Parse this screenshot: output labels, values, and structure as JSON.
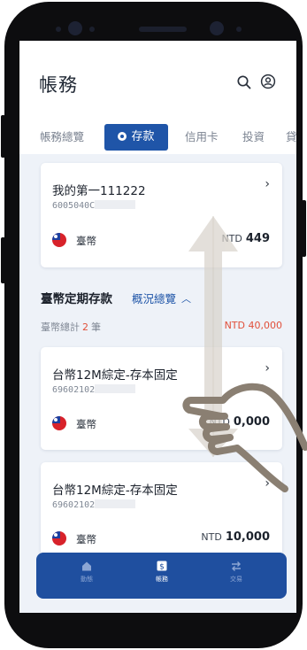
{
  "header": {
    "title": "帳務",
    "icons": [
      "search-icon",
      "profile-icon"
    ]
  },
  "tabs": [
    {
      "label": "帳務總覽"
    },
    {
      "label": "存款",
      "active": true
    },
    {
      "label": "信用卡"
    },
    {
      "label": "投資"
    },
    {
      "label": "貸"
    }
  ],
  "accounts": [
    {
      "name": "我的第一111222",
      "number": "6005040C",
      "currency": "臺幣",
      "ccy": "NTD",
      "balance": "449"
    }
  ],
  "fixed_deposit": {
    "section_title": "臺幣定期存款",
    "overview_link": "概況總覽",
    "total_label": "臺幣總計",
    "total_count": "2",
    "total_unit": "筆",
    "total_ccy": "NTD",
    "total_amount": "40,000",
    "items": [
      {
        "name": "台幣12M綜定-存本固定",
        "number": "69602102",
        "currency": "臺幣",
        "ccy": "NTD",
        "balance": "0,000"
      },
      {
        "name": "台幣12M綜定-存本固定",
        "number": "69602102",
        "currency": "臺幣",
        "ccy": "NTD",
        "balance": "10,000"
      }
    ]
  },
  "bottom_nav": [
    {
      "label": "動態",
      "icon": "home-icon"
    },
    {
      "label": "帳務",
      "icon": "dollar-icon",
      "active": true
    },
    {
      "label": "交易",
      "icon": "transfer-icon"
    }
  ],
  "colors": {
    "primary": "#1f55a8",
    "nav": "#1f4f9f",
    "highlight": "#e1503a",
    "background": "#eef2f8"
  }
}
